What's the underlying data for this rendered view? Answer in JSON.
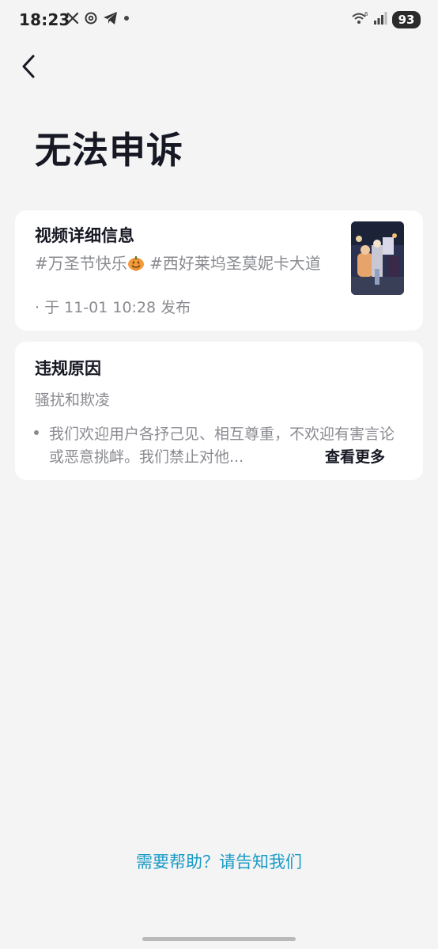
{
  "status_bar": {
    "time": "18:23",
    "battery": "93",
    "icons": [
      "x-icon",
      "threads-icon",
      "telegram-icon",
      "dot-icon",
      "wifi-icon",
      "signal-icon"
    ]
  },
  "header": {
    "back_icon": "chevron-left-icon",
    "title": "无法申诉"
  },
  "video_card": {
    "title": "视频详细信息",
    "desc_part1": "#万圣节快乐",
    "desc_part2": " #西好莱坞圣莫妮卡大道",
    "meta": "· 于 11-01 10:28 发布",
    "thumbnail_icon": "video-thumbnail"
  },
  "violation_card": {
    "title": "违规原因",
    "reason": "骚扰和欺凌",
    "detail": "我们欢迎用户各抒己见、相互尊重，不欢迎有害言论或恶意挑衅。我们禁止对他...",
    "see_more": "查看更多"
  },
  "footer": {
    "help_link": "需要帮助？请告知我们"
  },
  "colors": {
    "background": "#f4f4f4",
    "card": "#ffffff",
    "primary_text": "#161823",
    "secondary_text": "#8a8b91",
    "link": "#1b9bc6"
  }
}
